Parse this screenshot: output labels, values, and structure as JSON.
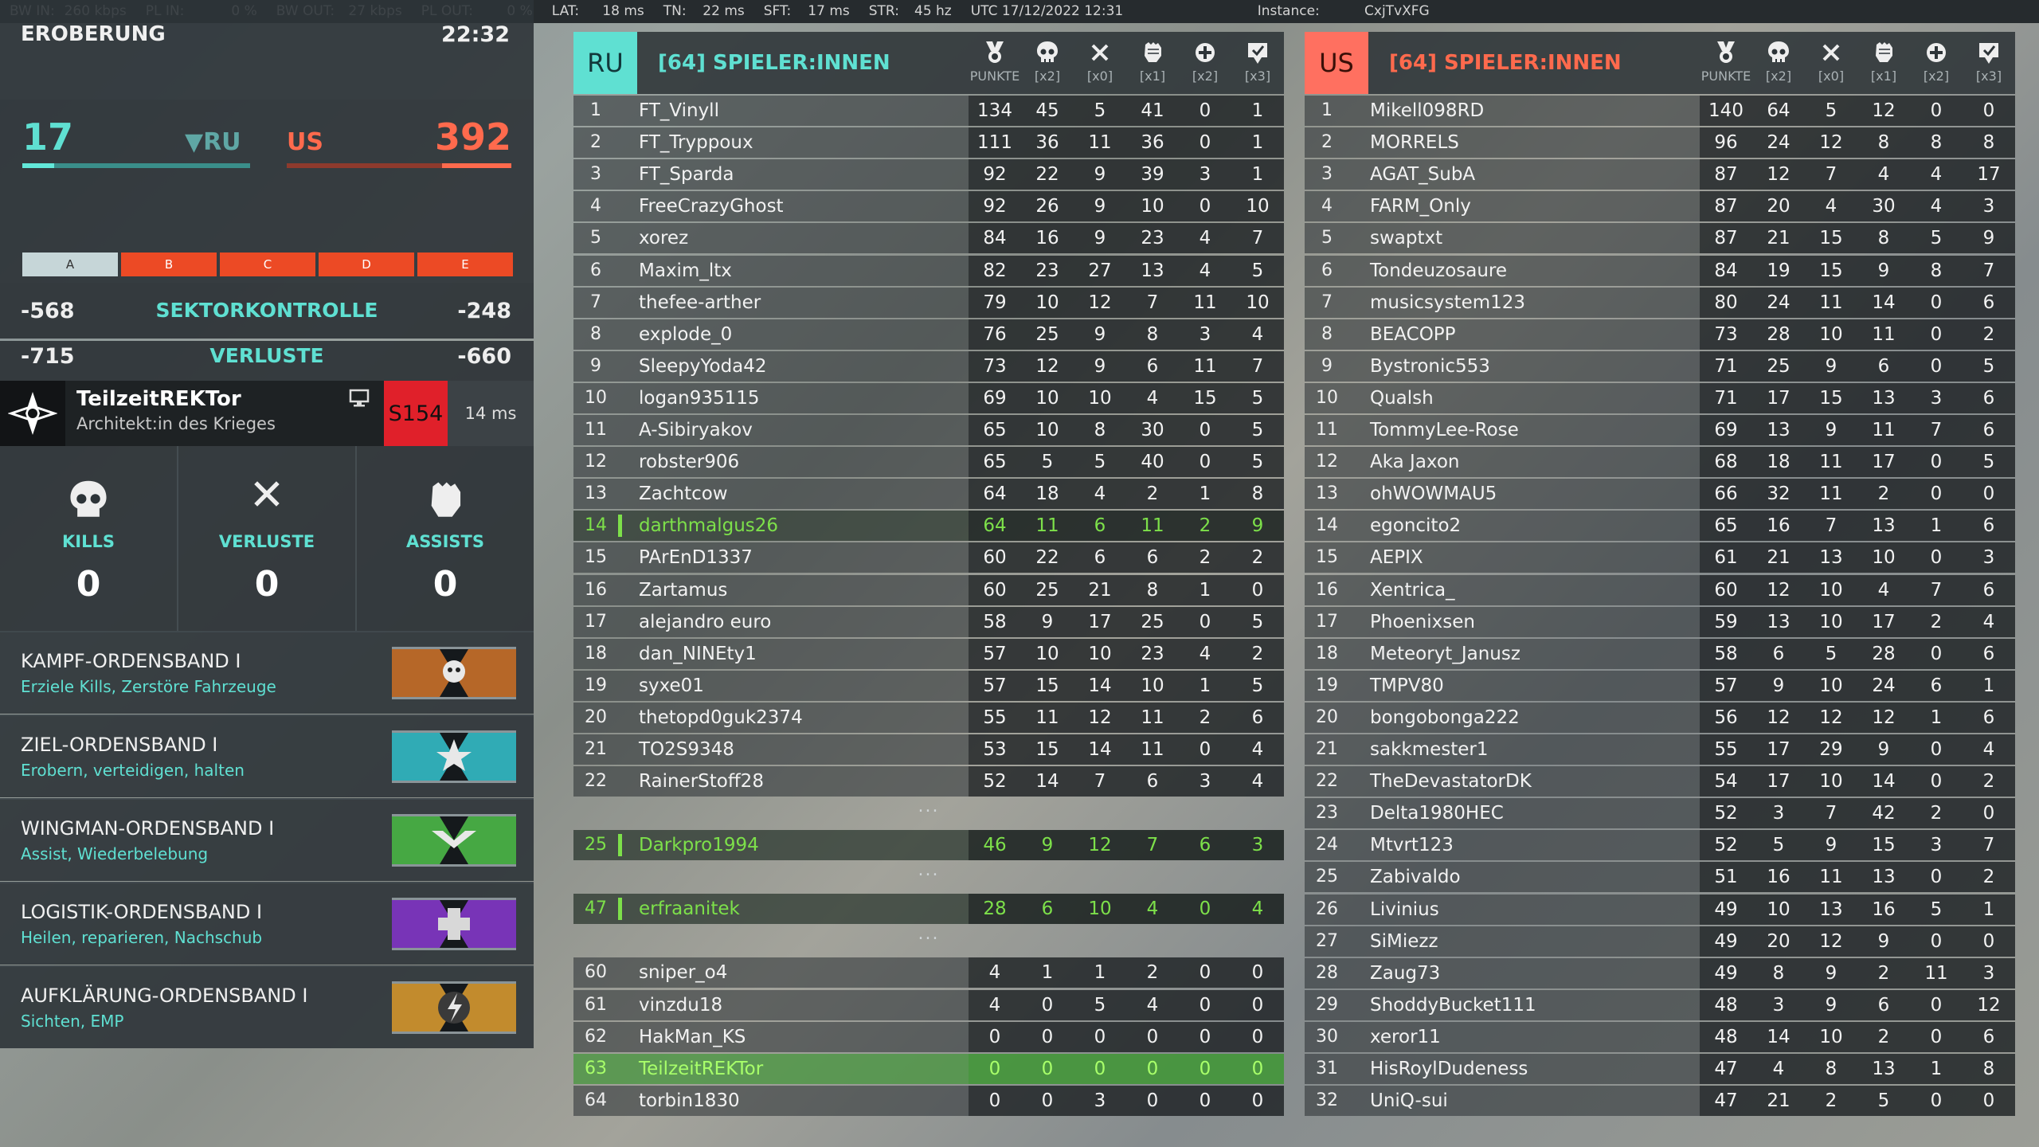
{
  "stats_bar": [
    {
      "label": "BW IN:",
      "value": "260 kbps"
    },
    {
      "label": "PL IN:",
      "value": "0 %"
    },
    {
      "label": "BW OUT:",
      "value": "27 kbps"
    },
    {
      "label": "PL OUT:",
      "value": "0 %"
    },
    {
      "label": "LAT:",
      "value": "18 ms"
    },
    {
      "label": "TN:",
      "value": "22 ms"
    },
    {
      "label": "SFT:",
      "value": "17 ms"
    },
    {
      "label": "STR:",
      "value": "45 hz"
    },
    {
      "label": "UTC 17/12/2022 12:31",
      "value": ""
    },
    {
      "label": "Instance:",
      "value": "CxjTvXFG"
    }
  ],
  "mode": {
    "name": "EROBERUNG",
    "time": "22:32"
  },
  "score": {
    "ru": "17",
    "ru_label": "▼RU",
    "us_label": "US",
    "us": "392",
    "ru_fill_fraction": 0.14,
    "us_fill_fraction": 0.31
  },
  "flags": [
    {
      "label": "A",
      "owner": "ru"
    },
    {
      "label": "B",
      "owner": "us"
    },
    {
      "label": "C",
      "owner": "us"
    },
    {
      "label": "D",
      "owner": "us"
    },
    {
      "label": "E",
      "owner": "us"
    }
  ],
  "sector": {
    "left": "-568",
    "label": "SEKTORKONTROLLE",
    "right": "-248"
  },
  "losses": {
    "left": "-715",
    "label": "VERLUSTE",
    "right": "-660"
  },
  "player": {
    "name": "TeilzeitREKTor",
    "subtitle": "Architekt:in des Krieges",
    "server": "S154",
    "ping": "14 ms"
  },
  "kva": [
    {
      "label": "KILLS",
      "value": "0",
      "icon": "skull-icon"
    },
    {
      "label": "VERLUSTE",
      "value": "0",
      "icon": "cross-icon"
    },
    {
      "label": "ASSISTS",
      "value": "0",
      "icon": "fist-icon"
    }
  ],
  "ribbons": [
    {
      "title": "KAMPF-ORDENSBAND I",
      "sub": "Erziele Kills, Zerstöre Fahrzeuge",
      "color": "#d2762a",
      "icon": "skull-ribbon-icon"
    },
    {
      "title": "ZIEL-ORDENSBAND I",
      "sub": "Erobern, verteidigen, halten",
      "color": "#35c5d0",
      "icon": "star-ribbon-icon"
    },
    {
      "title": "WINGMAN-ORDENSBAND I",
      "sub": "Assist, Wiederbelebung",
      "color": "#4fc24a",
      "icon": "wings-ribbon-icon"
    },
    {
      "title": "LOGISTIK-ORDENSBAND I",
      "sub": "Heilen, reparieren, Nachschub",
      "color": "#8a3ad2",
      "icon": "cross-ribbon-icon"
    },
    {
      "title": "AUFKLÄRUNG-ORDENSBAND I",
      "sub": "Sichten, EMP",
      "color": "#e0a030",
      "icon": "lightning-ribbon-icon"
    }
  ],
  "columns": [
    {
      "icon": "medal-icon",
      "label": "PUNKTE"
    },
    {
      "icon": "skull-icon",
      "label": "[x2]"
    },
    {
      "icon": "cross-icon",
      "label": "[x0]"
    },
    {
      "icon": "fist-icon",
      "label": "[x1]"
    },
    {
      "icon": "revive-icon",
      "label": "[x2]"
    },
    {
      "icon": "objective-icon",
      "label": "[x3]"
    }
  ],
  "teams": {
    "ru": {
      "code": "RU",
      "title": "[64] SPIELER:INNEN",
      "rows": [
        {
          "n": "1",
          "name": "FT_Vinyll",
          "s": [
            "134",
            "45",
            "5",
            "41",
            "0",
            "1"
          ]
        },
        {
          "n": "2",
          "name": "FT_Tryppoux",
          "s": [
            "111",
            "36",
            "11",
            "36",
            "0",
            "1"
          ]
        },
        {
          "n": "3",
          "name": "FT_Sparda",
          "s": [
            "92",
            "22",
            "9",
            "39",
            "3",
            "1"
          ]
        },
        {
          "n": "4",
          "name": "FreeCrazyGhost",
          "s": [
            "92",
            "26",
            "9",
            "10",
            "0",
            "10"
          ]
        },
        {
          "n": "5",
          "name": "xorez",
          "s": [
            "84",
            "16",
            "9",
            "23",
            "4",
            "7"
          ]
        },
        {
          "n": "6",
          "name": "Maxim_ltx",
          "s": [
            "82",
            "23",
            "27",
            "13",
            "4",
            "5"
          ]
        },
        {
          "n": "7",
          "name": "thefee-arther",
          "s": [
            "79",
            "10",
            "12",
            "7",
            "11",
            "10"
          ]
        },
        {
          "n": "8",
          "name": "explode_0",
          "s": [
            "76",
            "25",
            "9",
            "8",
            "3",
            "4"
          ]
        },
        {
          "n": "9",
          "name": "SleepyYoda42",
          "s": [
            "73",
            "12",
            "9",
            "6",
            "11",
            "7"
          ]
        },
        {
          "n": "10",
          "name": "logan935115",
          "s": [
            "69",
            "10",
            "10",
            "4",
            "15",
            "5"
          ]
        },
        {
          "n": "11",
          "name": "A-Sibiryakov",
          "s": [
            "65",
            "10",
            "8",
            "30",
            "0",
            "5"
          ]
        },
        {
          "n": "12",
          "name": "robster906",
          "s": [
            "65",
            "5",
            "5",
            "40",
            "0",
            "5"
          ]
        },
        {
          "n": "13",
          "name": "Zachtcow",
          "s": [
            "64",
            "18",
            "4",
            "2",
            "1",
            "8"
          ]
        },
        {
          "n": "14",
          "name": "darthmalgus26",
          "s": [
            "64",
            "11",
            "6",
            "11",
            "2",
            "9"
          ],
          "hl": true
        },
        {
          "n": "15",
          "name": "PArEnD1337",
          "s": [
            "60",
            "22",
            "6",
            "6",
            "2",
            "2"
          ]
        },
        {
          "n": "16",
          "name": "Zartamus",
          "s": [
            "60",
            "25",
            "21",
            "8",
            "1",
            "0"
          ]
        },
        {
          "n": "17",
          "name": "alejandro euro",
          "s": [
            "58",
            "9",
            "17",
            "25",
            "0",
            "5"
          ]
        },
        {
          "n": "18",
          "name": "dan_NINEty1",
          "s": [
            "57",
            "10",
            "10",
            "23",
            "4",
            "2"
          ]
        },
        {
          "n": "19",
          "name": "syxe01",
          "s": [
            "57",
            "15",
            "14",
            "10",
            "1",
            "5"
          ]
        },
        {
          "n": "20",
          "name": "thetopd0guk2374",
          "s": [
            "55",
            "11",
            "12",
            "11",
            "2",
            "6"
          ]
        },
        {
          "n": "21",
          "name": "TO2S9348",
          "s": [
            "53",
            "15",
            "14",
            "11",
            "0",
            "4"
          ]
        },
        {
          "n": "22",
          "name": "RainerStoff28",
          "s": [
            "52",
            "14",
            "7",
            "6",
            "3",
            "4"
          ]
        },
        {
          "gap": "..."
        },
        {
          "n": "25",
          "name": "Darkpro1994",
          "s": [
            "46",
            "9",
            "12",
            "7",
            "6",
            "3"
          ],
          "hl": true
        },
        {
          "gap": "..."
        },
        {
          "n": "47",
          "name": "erfraanitek",
          "s": [
            "28",
            "6",
            "10",
            "4",
            "0",
            "4"
          ],
          "hl": true
        },
        {
          "gap": "..."
        },
        {
          "n": "60",
          "name": "sniper_o4",
          "s": [
            "4",
            "1",
            "1",
            "2",
            "0",
            "0"
          ]
        },
        {
          "n": "61",
          "name": "vinzdu18",
          "s": [
            "4",
            "0",
            "5",
            "4",
            "0",
            "0"
          ]
        },
        {
          "n": "62",
          "name": "HakMan_KS",
          "s": [
            "0",
            "0",
            "0",
            "0",
            "0",
            "0"
          ]
        },
        {
          "n": "63",
          "name": "TeilzeitREKTor",
          "s": [
            "0",
            "0",
            "0",
            "0",
            "0",
            "0"
          ],
          "self": true
        },
        {
          "n": "64",
          "name": "torbin1830",
          "s": [
            "0",
            "0",
            "3",
            "0",
            "0",
            "0"
          ]
        }
      ]
    },
    "us": {
      "code": "US",
      "title": "[64] SPIELER:INNEN",
      "rows": [
        {
          "n": "1",
          "name": "Mikell098RD",
          "s": [
            "140",
            "64",
            "5",
            "12",
            "0",
            "0"
          ]
        },
        {
          "n": "2",
          "name": "MORRELS",
          "s": [
            "96",
            "24",
            "12",
            "8",
            "8",
            "8"
          ]
        },
        {
          "n": "3",
          "name": "AGAT_SubA",
          "s": [
            "87",
            "12",
            "7",
            "4",
            "4",
            "17"
          ]
        },
        {
          "n": "4",
          "name": "FARM_Only",
          "s": [
            "87",
            "20",
            "4",
            "30",
            "4",
            "3"
          ]
        },
        {
          "n": "5",
          "name": "swaptxt",
          "s": [
            "87",
            "21",
            "15",
            "8",
            "5",
            "9"
          ]
        },
        {
          "n": "6",
          "name": "Tondeuzosaure",
          "s": [
            "84",
            "19",
            "15",
            "9",
            "8",
            "7"
          ]
        },
        {
          "n": "7",
          "name": "musicsystem123",
          "s": [
            "80",
            "24",
            "11",
            "14",
            "0",
            "6"
          ]
        },
        {
          "n": "8",
          "name": "BEACOPP",
          "s": [
            "73",
            "28",
            "10",
            "11",
            "0",
            "2"
          ]
        },
        {
          "n": "9",
          "name": "Bystronic553",
          "s": [
            "71",
            "25",
            "9",
            "6",
            "0",
            "5"
          ]
        },
        {
          "n": "10",
          "name": "Qualsh",
          "s": [
            "71",
            "17",
            "15",
            "13",
            "3",
            "6"
          ]
        },
        {
          "n": "11",
          "name": "TommyLee-Rose",
          "s": [
            "69",
            "13",
            "9",
            "11",
            "7",
            "6"
          ]
        },
        {
          "n": "12",
          "name": "Aka Jaxon",
          "s": [
            "68",
            "18",
            "11",
            "17",
            "0",
            "5"
          ]
        },
        {
          "n": "13",
          "name": "ohWOWMAU5",
          "s": [
            "66",
            "32",
            "11",
            "2",
            "0",
            "0"
          ]
        },
        {
          "n": "14",
          "name": "egoncito2",
          "s": [
            "65",
            "16",
            "7",
            "13",
            "1",
            "6"
          ]
        },
        {
          "n": "15",
          "name": "AEPIX",
          "s": [
            "61",
            "21",
            "13",
            "10",
            "0",
            "3"
          ]
        },
        {
          "n": "16",
          "name": "Xentrica_",
          "s": [
            "60",
            "12",
            "10",
            "4",
            "7",
            "6"
          ]
        },
        {
          "n": "17",
          "name": "Phoenixsen",
          "s": [
            "59",
            "13",
            "10",
            "17",
            "2",
            "4"
          ]
        },
        {
          "n": "18",
          "name": "Meteoryt_Janusz",
          "s": [
            "58",
            "6",
            "5",
            "28",
            "0",
            "6"
          ]
        },
        {
          "n": "19",
          "name": "TMPV80",
          "s": [
            "57",
            "9",
            "10",
            "24",
            "6",
            "1"
          ]
        },
        {
          "n": "20",
          "name": "bongobonga222",
          "s": [
            "56",
            "12",
            "12",
            "12",
            "1",
            "6"
          ]
        },
        {
          "n": "21",
          "name": "sakkmester1",
          "s": [
            "55",
            "17",
            "29",
            "9",
            "0",
            "4"
          ]
        },
        {
          "n": "22",
          "name": "TheDevastatorDK",
          "s": [
            "54",
            "17",
            "10",
            "14",
            "0",
            "2"
          ]
        },
        {
          "n": "23",
          "name": "Delta1980HEC",
          "s": [
            "52",
            "3",
            "7",
            "42",
            "2",
            "0"
          ]
        },
        {
          "n": "24",
          "name": "Mtvrt123",
          "s": [
            "52",
            "5",
            "9",
            "15",
            "3",
            "7"
          ]
        },
        {
          "n": "25",
          "name": "Zabivaldo",
          "s": [
            "51",
            "16",
            "11",
            "13",
            "0",
            "2"
          ]
        },
        {
          "n": "26",
          "name": "Livinius",
          "s": [
            "49",
            "10",
            "13",
            "16",
            "5",
            "1"
          ]
        },
        {
          "n": "27",
          "name": "SiMiezz",
          "s": [
            "49",
            "20",
            "12",
            "9",
            "0",
            "0"
          ]
        },
        {
          "n": "28",
          "name": "Zaug73",
          "s": [
            "49",
            "8",
            "9",
            "2",
            "11",
            "3"
          ]
        },
        {
          "n": "29",
          "name": "ShoddyBucket111",
          "s": [
            "48",
            "3",
            "9",
            "6",
            "0",
            "12"
          ]
        },
        {
          "n": "30",
          "name": "xeror11",
          "s": [
            "48",
            "14",
            "10",
            "2",
            "0",
            "6"
          ]
        },
        {
          "n": "31",
          "name": "HisRoylDudeness",
          "s": [
            "47",
            "4",
            "8",
            "13",
            "1",
            "8"
          ]
        },
        {
          "n": "32",
          "name": "UniQ-sui",
          "s": [
            "47",
            "21",
            "2",
            "5",
            "0",
            "0"
          ]
        }
      ]
    }
  }
}
